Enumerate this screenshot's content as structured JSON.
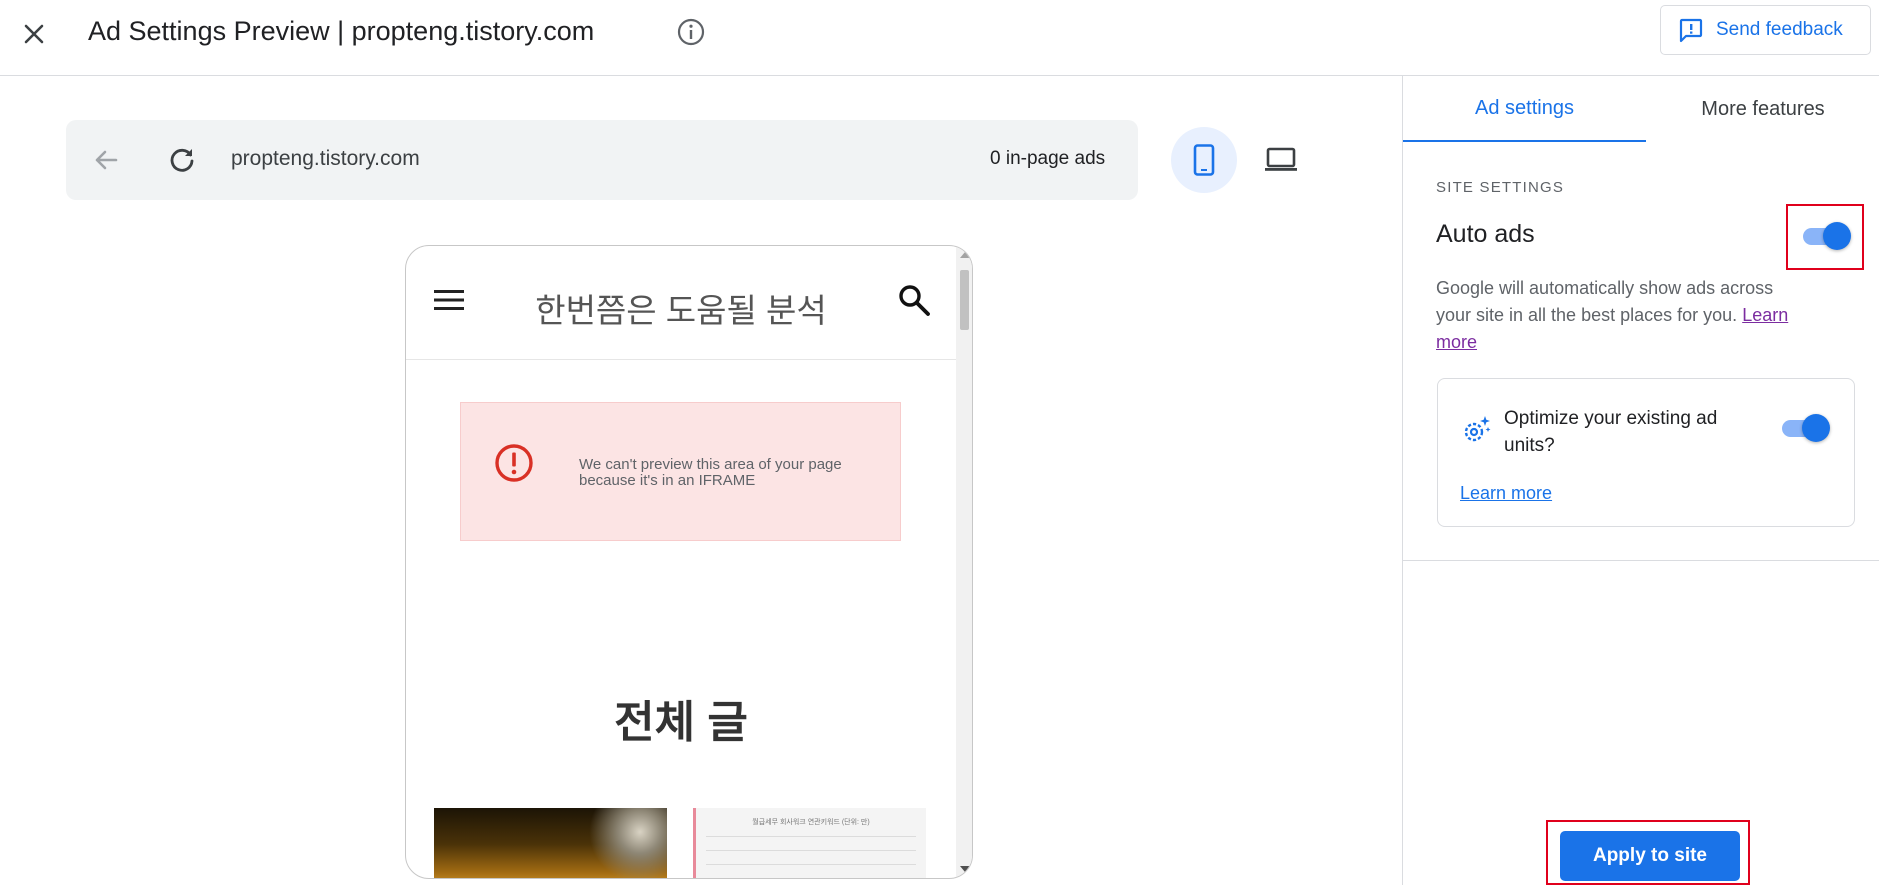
{
  "header": {
    "title": "Ad Settings Preview | propteng.tistory.com",
    "feedback_label": "Send feedback"
  },
  "preview": {
    "url": "propteng.tistory.com",
    "ad_count": "0 in-page ads",
    "devices": [
      "mobile",
      "desktop"
    ],
    "selected_device": "mobile"
  },
  "phone": {
    "blog_title": "한번쯤은 도움될 분석",
    "iframe_message": "We can't preview this area of your page because it's in an IFRAME",
    "section_title": "전체 글",
    "thumb2_caption": "월급세무 회사워크 연관키워드 (단위: 만)"
  },
  "panel": {
    "tabs": [
      {
        "label": "Ad settings",
        "active": true
      },
      {
        "label": "More features",
        "active": false
      }
    ],
    "section_label": "SITE SETTINGS",
    "auto_ads": {
      "label": "Auto ads",
      "enabled": true,
      "description": "Google will automatically show ads across your site in all the best places for you.",
      "learn_more": "Learn more"
    },
    "optimize": {
      "label": "Optimize your existing ad units?",
      "enabled": true,
      "learn_more": "Learn more"
    },
    "apply_label": "Apply to site"
  },
  "colors": {
    "accent": "#1a73e8",
    "toggle_track": "#8ab4f8",
    "iframe_bg": "#fce4e4",
    "error": "#d93025",
    "highlight": "#e0001c"
  }
}
